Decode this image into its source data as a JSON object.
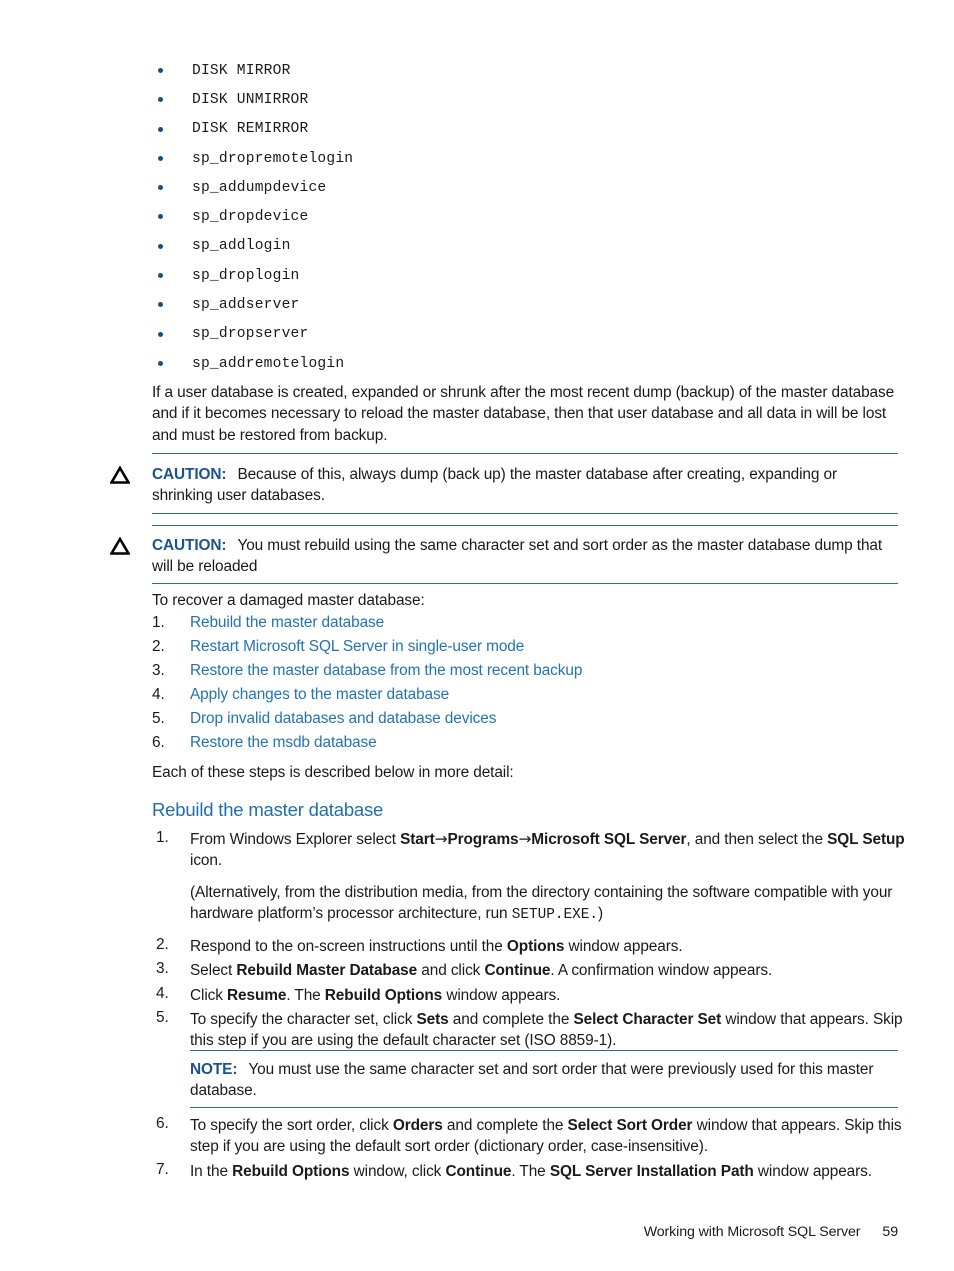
{
  "document": {
    "commands": [
      "DISK MIRROR",
      "DISK UNMIRROR",
      "DISK REMIRROR",
      "sp_dropremotelogin",
      "sp_addumpdevice",
      "sp_dropdevice",
      "sp_addlogin",
      "sp_droplogin",
      "sp_addserver",
      "sp_dropserver",
      "sp_addremotelogin"
    ],
    "intro_paragraph": "If a user database is created, expanded or shrunk after the most recent dump (backup) of the master database and if it becomes necessary to reload the master database, then that user database and all data in will be lost and must be restored from backup.",
    "caution_1": {
      "label": "CAUTION:",
      "text": "Because of this, always dump (back up) the master database after creating, expanding or shrinking user databases."
    },
    "caution_2": {
      "label": "CAUTION:",
      "text": "You must rebuild using the same character set and sort order as the master database dump that will be reloaded"
    },
    "recover_lead": "To recover a damaged master database:",
    "recover_steps": [
      {
        "num": "1.",
        "label": "Rebuild the master database"
      },
      {
        "num": "2.",
        "label": "Restart Microsoft SQL Server in single-user mode"
      },
      {
        "num": "3.",
        "label": "Restore the master database from the most recent backup"
      },
      {
        "num": "4.",
        "label": "Apply changes to the master database"
      },
      {
        "num": "5.",
        "label": "Drop invalid databases and database devices"
      },
      {
        "num": "6.",
        "label": "Restore the msdb database"
      }
    ],
    "detail_lead": "Each of these steps is described below in more detail:",
    "section_heading": "Rebuild the master database",
    "procedure": {
      "step1": {
        "num": "1.",
        "part_a": "From Windows Explorer select ",
        "bold_start": "Start",
        "arrow1": "→",
        "bold_programs": "Programs",
        "arrow2": "→",
        "bold_mssql": "Microsoft SQL Server",
        "part_b": ", and then select the ",
        "bold_sqlsetup": "SQL Setup",
        "part_c": " icon.",
        "alt_a": "(Alternatively, from the distribution media, from the directory containing the software compatible with your hardware platform’s processor architecture, run ",
        "alt_mono": "SETUP.EXE.",
        "alt_b": ")"
      },
      "step2": {
        "num": "2.",
        "part_a": "Respond to the on-screen instructions until the ",
        "bold_options": "Options",
        "part_b": " window appears."
      },
      "step3": {
        "num": "3.",
        "part_a": "Select ",
        "bold_rebuild": "Rebuild Master Database",
        "part_b": " and click ",
        "bold_continue": "Continue",
        "part_c": ". A confirmation window appears."
      },
      "step4": {
        "num": "4.",
        "part_a": "Click ",
        "bold_resume": "Resume",
        "part_b": ". The ",
        "bold_rebuildopts": "Rebuild Options",
        "part_c": " window appears."
      },
      "step5": {
        "num": "5.",
        "part_a": "To specify the character set, click ",
        "bold_sets": "Sets",
        "part_b": " and complete the ",
        "bold_charset": "Select Character Set",
        "part_c": " window that appears. Skip this step if you are using the default character set (ISO 8859-1)."
      },
      "step6": {
        "num": "6.",
        "part_a": "To specify the sort order, click ",
        "bold_orders": "Orders",
        "part_b": " and complete the ",
        "bold_sortorder": "Select Sort Order",
        "part_c": " window that appears. Skip this step if you are using the default sort order (dictionary order, case-insensitive)."
      },
      "step7": {
        "num": "7.",
        "part_a": "In the ",
        "bold_rebuildopts": "Rebuild Options",
        "part_b": " window, click ",
        "bold_continue": "Continue",
        "part_c": ". The ",
        "bold_installpath": "SQL Server Installation Path",
        "part_d": " window appears."
      }
    },
    "note": {
      "label": "NOTE:",
      "text": "You must use the same character set and sort order that were previously used for this master database."
    },
    "footer": {
      "title": "Working with Microsoft SQL Server",
      "page": "59"
    },
    "colors": {
      "link_blue": "#2274b0",
      "heading_blue": "#1f6fa8",
      "label_blue": "#1a5490",
      "rule_blue": "#2d6a96",
      "bullet_blue": "#1a4f7a"
    }
  }
}
